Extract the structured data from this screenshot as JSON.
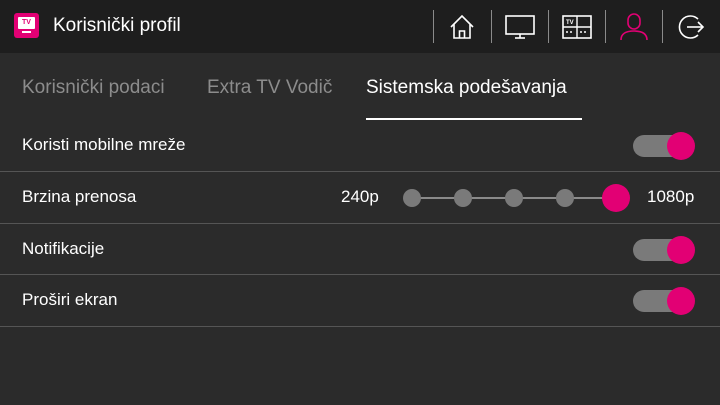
{
  "app": {
    "title": "Korisnički profil",
    "logo_text": "TV",
    "accent_color": "#e20074"
  },
  "nav": [
    {
      "name": "home-icon",
      "label": ""
    },
    {
      "name": "tv-icon",
      "label": ""
    },
    {
      "name": "tv-guide-icon",
      "label": ""
    },
    {
      "name": "user-icon",
      "label": "",
      "active": true
    },
    {
      "name": "logout-icon",
      "label": ""
    }
  ],
  "tabs": [
    {
      "label": "Korisnički podaci",
      "active": false
    },
    {
      "label": "Extra TV Vodič",
      "active": false
    },
    {
      "label": "Sistemska podešavanja",
      "active": true
    }
  ],
  "settings": {
    "mobile_networks": {
      "label": "Koristi mobilne mreže",
      "enabled": true
    },
    "transfer_speed": {
      "label": "Brzina prenosa",
      "min_label": "240p",
      "max_label": "1080p",
      "steps": 5,
      "selected_step": 5
    },
    "notifications": {
      "label": "Notifikacije",
      "enabled": true
    },
    "expand_screen": {
      "label": "Proširi ekran",
      "enabled": true
    }
  }
}
